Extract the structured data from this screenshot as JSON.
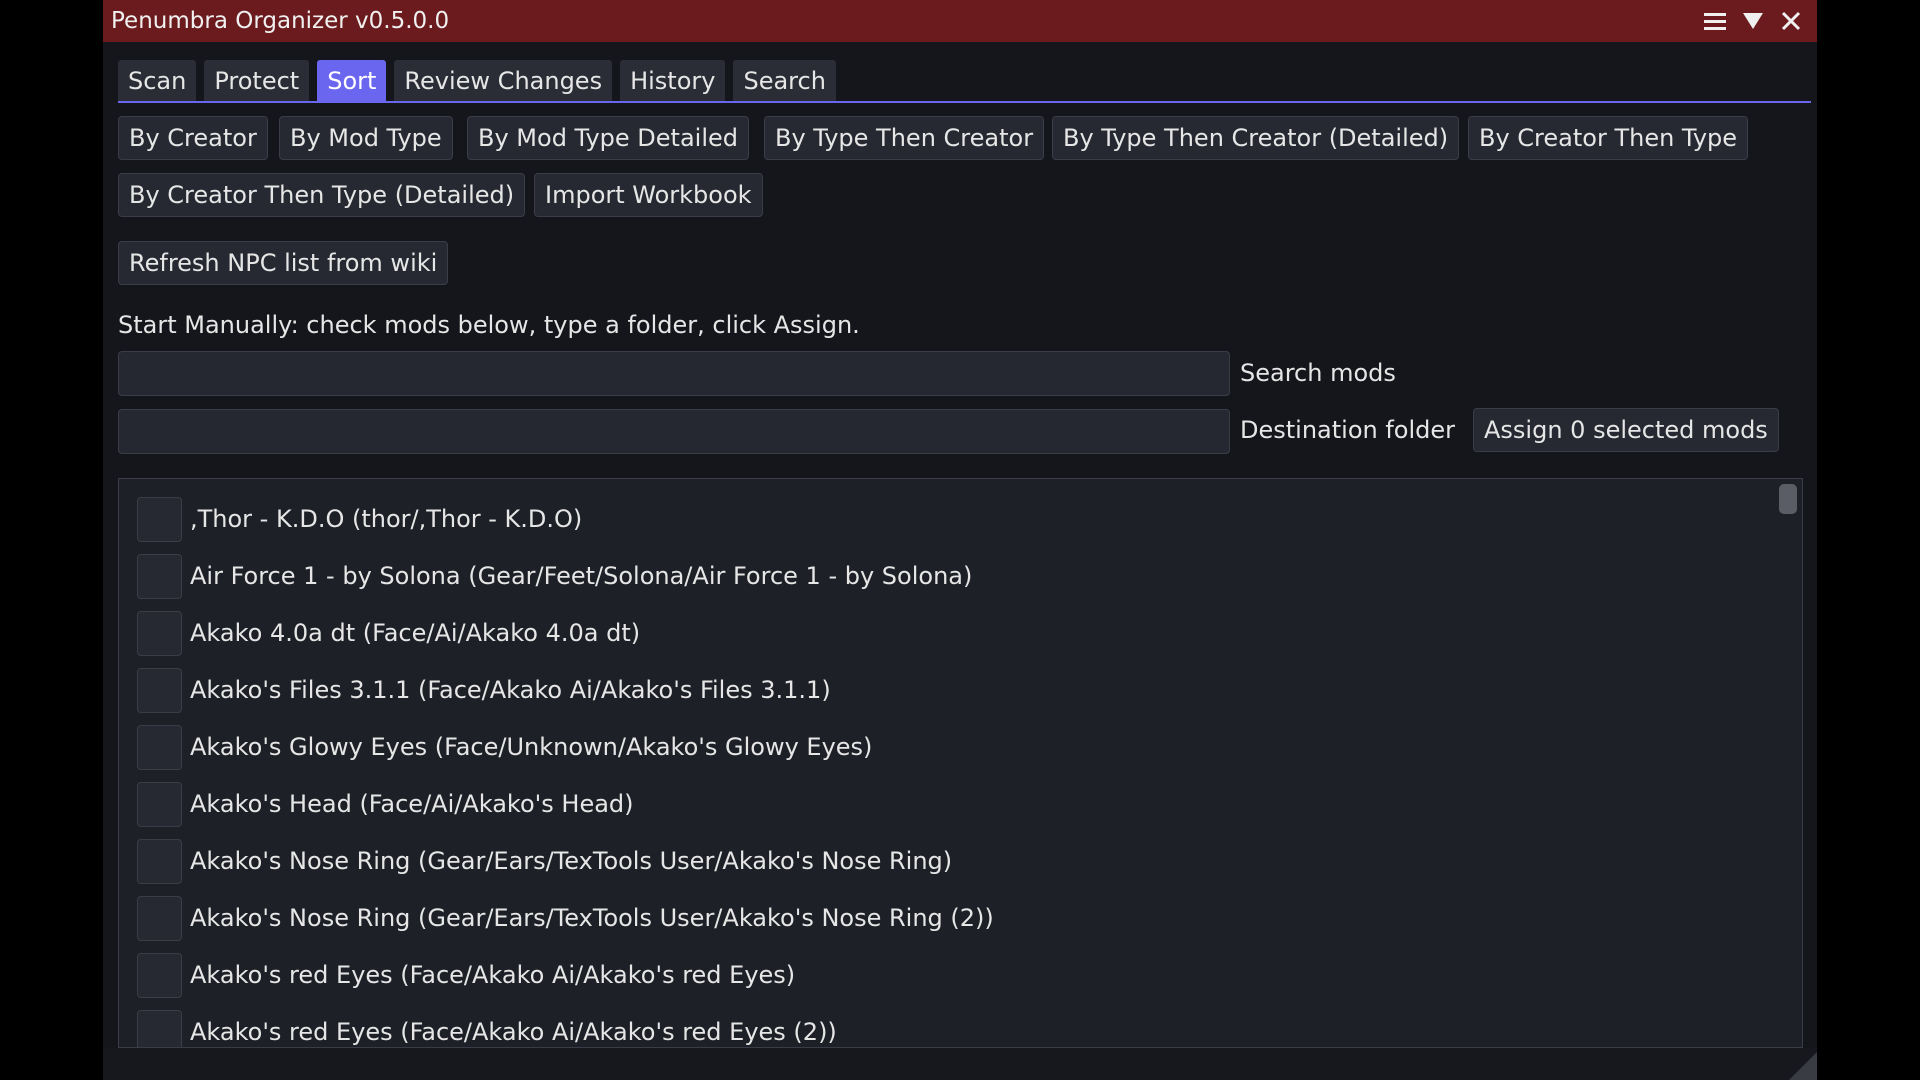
{
  "window": {
    "title": "Penumbra Organizer v0.5.0.0"
  },
  "title_icons": [
    "hamburger-menu-icon",
    "collapse-triangle-icon",
    "close-icon"
  ],
  "tabs": [
    {
      "label": "Scan",
      "active": false
    },
    {
      "label": "Protect",
      "active": false
    },
    {
      "label": "Sort",
      "active": true
    },
    {
      "label": "Review Changes",
      "active": false
    },
    {
      "label": "History",
      "active": false
    },
    {
      "label": "Search",
      "active": false
    }
  ],
  "sort_buttons": [
    "By Creator",
    "By Mod Type",
    "By Mod Type Detailed",
    "By Type Then Creator",
    "By Type Then Creator (Detailed)",
    "By Creator Then Type",
    "By Creator Then Type (Detailed)",
    "Import Workbook"
  ],
  "refresh_button": "Refresh NPC list from wiki",
  "manual_hint": "Start Manually: check mods below, type a folder, click Assign.",
  "search": {
    "value": "",
    "label": "Search mods"
  },
  "destination": {
    "value": "",
    "label": "Destination folder"
  },
  "assign_button": "Assign 0 selected mods",
  "mods": [
    {
      "label": ",Thor - K.D.O (thor/,Thor - K.D.O)",
      "checked": false
    },
    {
      "label": "Air Force 1 - by Solona (Gear/Feet/Solona/Air Force 1 - by Solona)",
      "checked": false
    },
    {
      "label": "Akako 4.0a dt (Face/Ai/Akako 4.0a dt)",
      "checked": false
    },
    {
      "label": "Akako's Files 3.1.1 (Face/Akako Ai/Akako's Files 3.1.1)",
      "checked": false
    },
    {
      "label": "Akako's Glowy Eyes (Face/Unknown/Akako's Glowy Eyes)",
      "checked": false
    },
    {
      "label": "Akako's Head (Face/Ai/Akako's Head)",
      "checked": false
    },
    {
      "label": "Akako's Nose Ring (Gear/Ears/TexTools User/Akako's Nose Ring)",
      "checked": false
    },
    {
      "label": "Akako's Nose Ring (Gear/Ears/TexTools User/Akako's Nose Ring (2))",
      "checked": false
    },
    {
      "label": "Akako's red Eyes (Face/Akako Ai/Akako's red Eyes)",
      "checked": false
    },
    {
      "label": "Akako's red Eyes (Face/Akako Ai/Akako's red Eyes (2))",
      "checked": false
    }
  ],
  "colors": {
    "titlebar": "#6b1b1e",
    "accent": "#6b66f0",
    "background": "#15161c"
  }
}
